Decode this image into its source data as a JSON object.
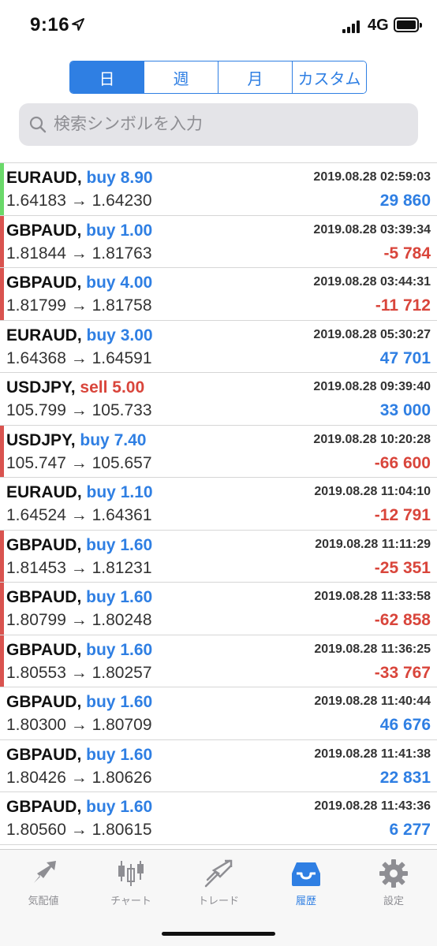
{
  "status_bar": {
    "time": "9:16",
    "network": "4G"
  },
  "periods": {
    "tabs": [
      "日",
      "週",
      "月",
      "カスタム"
    ],
    "active_index": 0
  },
  "search": {
    "placeholder": "検索シンボルを入力"
  },
  "colors": {
    "accent": "#2f7fe3",
    "loss": "#d9453b",
    "gain": "#2f7fe3",
    "gain_bar": "#6ad96a",
    "loss_bar": "#d9534f"
  },
  "trades": [
    {
      "symbol": "EURAUD,",
      "side": "buy",
      "volume": "8.90",
      "open": "1.64183",
      "close": "1.64230",
      "time": "2019.08.28 02:59:03",
      "profit": "29 860",
      "result": "gain",
      "bar": "gain"
    },
    {
      "symbol": "GBPAUD,",
      "side": "buy",
      "volume": "1.00",
      "open": "1.81844",
      "close": "1.81763",
      "time": "2019.08.28 03:39:34",
      "profit": "-5 784",
      "result": "loss",
      "bar": "loss"
    },
    {
      "symbol": "GBPAUD,",
      "side": "buy",
      "volume": "4.00",
      "open": "1.81799",
      "close": "1.81758",
      "time": "2019.08.28 03:44:31",
      "profit": "-11 712",
      "result": "loss",
      "bar": "loss"
    },
    {
      "symbol": "EURAUD,",
      "side": "buy",
      "volume": "3.00",
      "open": "1.64368",
      "close": "1.64591",
      "time": "2019.08.28 05:30:27",
      "profit": "47 701",
      "result": "gain",
      "bar": "none"
    },
    {
      "symbol": "USDJPY,",
      "side": "sell",
      "volume": "5.00",
      "open": "105.799",
      "close": "105.733",
      "time": "2019.08.28 09:39:40",
      "profit": "33 000",
      "result": "gain",
      "bar": "none"
    },
    {
      "symbol": "USDJPY,",
      "side": "buy",
      "volume": "7.40",
      "open": "105.747",
      "close": "105.657",
      "time": "2019.08.28 10:20:28",
      "profit": "-66 600",
      "result": "loss",
      "bar": "loss"
    },
    {
      "symbol": "EURAUD,",
      "side": "buy",
      "volume": "1.10",
      "open": "1.64524",
      "close": "1.64361",
      "time": "2019.08.28 11:04:10",
      "profit": "-12 791",
      "result": "loss",
      "bar": "none"
    },
    {
      "symbol": "GBPAUD,",
      "side": "buy",
      "volume": "1.60",
      "open": "1.81453",
      "close": "1.81231",
      "time": "2019.08.28 11:11:29",
      "profit": "-25 351",
      "result": "loss",
      "bar": "loss"
    },
    {
      "symbol": "GBPAUD,",
      "side": "buy",
      "volume": "1.60",
      "open": "1.80799",
      "close": "1.80248",
      "time": "2019.08.28 11:33:58",
      "profit": "-62 858",
      "result": "loss",
      "bar": "loss"
    },
    {
      "symbol": "GBPAUD,",
      "side": "buy",
      "volume": "1.60",
      "open": "1.80553",
      "close": "1.80257",
      "time": "2019.08.28 11:36:25",
      "profit": "-33 767",
      "result": "loss",
      "bar": "loss"
    },
    {
      "symbol": "GBPAUD,",
      "side": "buy",
      "volume": "1.60",
      "open": "1.80300",
      "close": "1.80709",
      "time": "2019.08.28 11:40:44",
      "profit": "46 676",
      "result": "gain",
      "bar": "none"
    },
    {
      "symbol": "GBPAUD,",
      "side": "buy",
      "volume": "1.60",
      "open": "1.80426",
      "close": "1.80626",
      "time": "2019.08.28 11:41:38",
      "profit": "22 831",
      "result": "gain",
      "bar": "none"
    },
    {
      "symbol": "GBPAUD,",
      "side": "buy",
      "volume": "1.60",
      "open": "1.80560",
      "close": "1.80615",
      "time": "2019.08.28 11:43:36",
      "profit": "6 277",
      "result": "gain",
      "bar": "none"
    }
  ],
  "tabbar": {
    "items": [
      {
        "label": "気配値",
        "icon": "quotes-icon"
      },
      {
        "label": "チャート",
        "icon": "chart-icon"
      },
      {
        "label": "トレード",
        "icon": "trade-icon"
      },
      {
        "label": "履歴",
        "icon": "history-icon"
      },
      {
        "label": "設定",
        "icon": "settings-icon"
      }
    ],
    "active_index": 3
  }
}
